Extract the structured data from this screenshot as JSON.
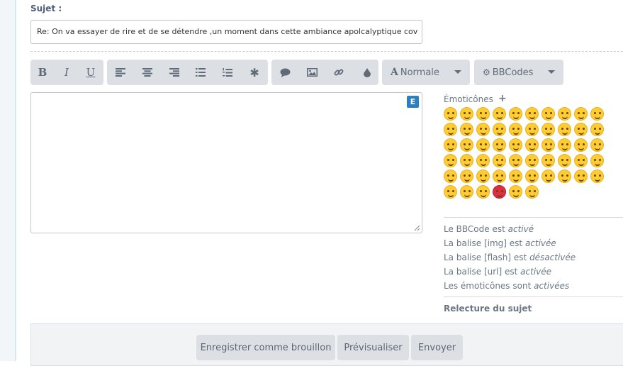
{
  "subject": {
    "label": "Sujet :",
    "value": "Re: On va essayer de rire et de se détendre ,un moment dans cette ambiance apolcalyptique cov"
  },
  "toolbar": {
    "bold": "B",
    "italic": "I",
    "underline": "U",
    "font_size_label": "Normale",
    "bbcodes_label": "BBCodes",
    "icons": [
      "bold-icon",
      "italic-icon",
      "underline-icon",
      "align-left-icon",
      "align-center-icon",
      "align-right-icon",
      "bullet-list-icon",
      "numbered-list-icon",
      "asterisk-icon",
      "quote-icon",
      "image-icon",
      "link-icon",
      "color-drop-icon",
      "font-icon",
      "gear-icon"
    ]
  },
  "editor": {
    "badge": "E",
    "value": ""
  },
  "emoticons": {
    "title": "Émoticônes",
    "add": "+",
    "count": 56
  },
  "status": {
    "bbcode_prefix": "Le BBCode est",
    "bbcode_state": "activé",
    "img_prefix": "La balise [img] est",
    "img_state": "activée",
    "flash_prefix": "La balise [flash] est",
    "flash_state": "désactivée",
    "url_prefix": "La balise [url] est",
    "url_state": "activée",
    "smilies_prefix": "Les émoticônes sont",
    "smilies_state": "activées"
  },
  "relecture": "Relecture du sujet",
  "buttons": {
    "draft": "Enregistrer comme brouillon",
    "preview": "Prévisualiser",
    "send": "Envoyer"
  },
  "colors": {
    "toolbar_bg": "#dcdfe4",
    "badge": "#2b7fc3",
    "emoji": "#ffcc33"
  }
}
